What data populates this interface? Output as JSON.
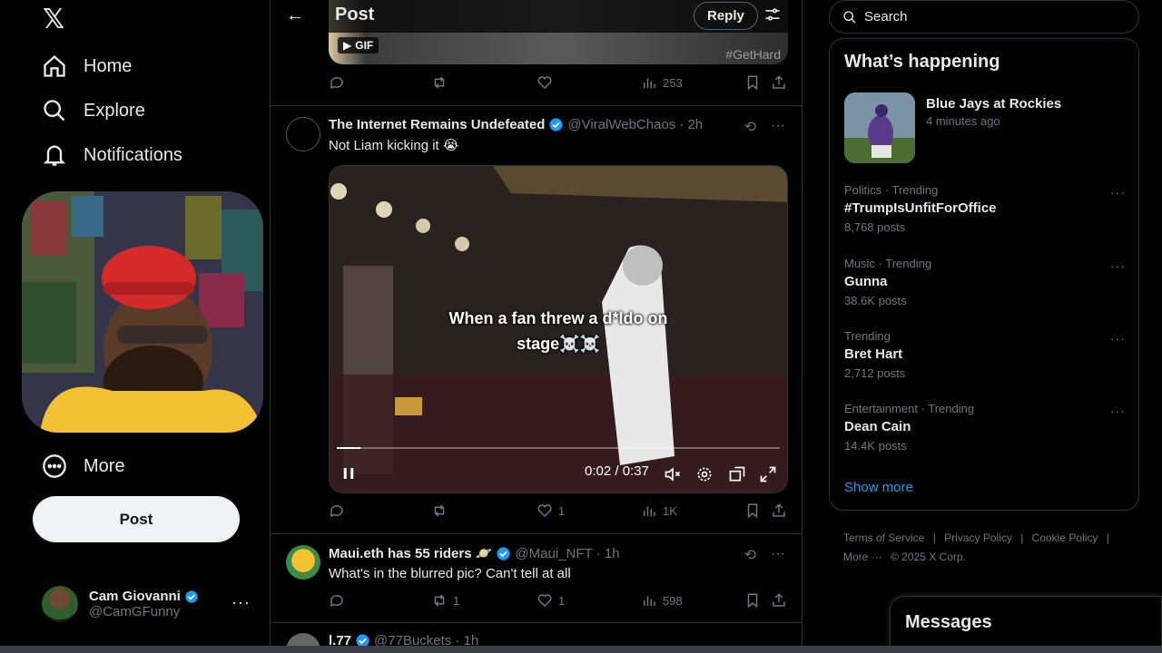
{
  "nav": {
    "items": [
      {
        "label": "Home",
        "icon": "home-icon"
      },
      {
        "label": "Explore",
        "icon": "search-icon"
      },
      {
        "label": "Notifications",
        "icon": "bell-icon"
      },
      {
        "label": "More",
        "icon": "more-circle-icon"
      }
    ],
    "post_label": "Post",
    "account": {
      "display_name": "Cam Giovanni",
      "handle": "@CamGFunny"
    }
  },
  "header": {
    "title": "Post",
    "reply_label": "Reply"
  },
  "prev_tweet": {
    "gif_label": "GIF",
    "hashtag": "#GetHard",
    "views": "253"
  },
  "tweets": [
    {
      "name": "The Internet Remains Undefeated",
      "handle": "@ViralWebChaos",
      "time": "· 2h",
      "text": "Not Liam kicking it 😭",
      "video_caption_1": "When a fan threw a d*ldo on",
      "video_caption_2": "stage☠️☠️",
      "video_time": "0:02 / 0:37",
      "video_progress": 0.054,
      "reposts": "",
      "likes": "1",
      "views": "1K"
    },
    {
      "name": "Maui.eth has 55 riders 🪐",
      "handle": "@Maui_NFT",
      "time": "· 1h",
      "text": "What's in the blurred pic? Can't tell at all",
      "reposts": "1",
      "likes": "1",
      "views": "598"
    },
    {
      "name": "l.77",
      "handle": "@77Buckets",
      "time": "· 1h"
    }
  ],
  "search": {
    "placeholder": "Search"
  },
  "trends": {
    "heading": "What’s happening",
    "featured": {
      "title": "Blue Jays at Rockies",
      "time": "4 minutes ago"
    },
    "items": [
      {
        "category": "Politics · Trending",
        "name": "#TrumpIsUnfitForOffice",
        "count": "8,768 posts"
      },
      {
        "category": "Music · Trending",
        "name": "Gunna",
        "count": "38.6K posts"
      },
      {
        "category": "Trending",
        "name": "Bret Hart",
        "count": "2,712 posts"
      },
      {
        "category": "Entertainment · Trending",
        "name": "Dean Cain",
        "count": "14.4K posts"
      }
    ],
    "show_more": "Show more"
  },
  "footer": {
    "links": [
      "Terms of Service",
      "|",
      "Privacy Policy",
      "|",
      "Cookie Policy",
      "|"
    ],
    "more": "More ···",
    "copyright": "© 2025 X Corp."
  },
  "messages": {
    "label": "Messages"
  },
  "colors": {
    "accent": "#1d9bf0",
    "background": "#000000",
    "border": "#2f3336",
    "muted": "#71767b"
  }
}
